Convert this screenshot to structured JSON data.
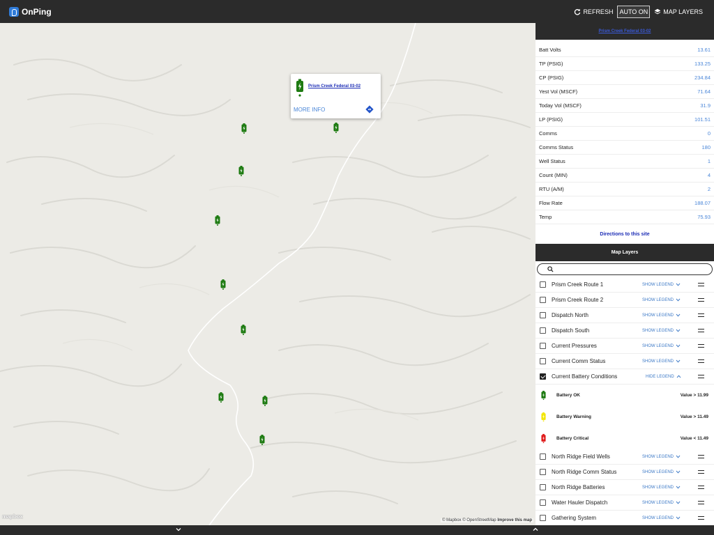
{
  "header": {
    "app_name": "OnPing",
    "refresh_label": "REFRESH",
    "auto_label": "AUTO ON",
    "map_layers_label": "MAP LAYERS"
  },
  "map": {
    "popup": {
      "title": "Prism Creek Federal 03-02",
      "more_info_label": "MORE INFO"
    },
    "brand": "mapbox",
    "attribution": "© Mapbox © OpenStreetMap",
    "improve_label": "Improve this map",
    "marker_color": "#1e7b12"
  },
  "site_panel": {
    "title": "Prism Creek Federal 03-02",
    "metrics": [
      {
        "label": "Batt Volts",
        "value": "13.61"
      },
      {
        "label": "TP (PSIG)",
        "value": "133.25"
      },
      {
        "label": "CP (PSIG)",
        "value": "234.84"
      },
      {
        "label": "Yest Vol (MSCF)",
        "value": "71.64"
      },
      {
        "label": "Today Vol (MSCF)",
        "value": "31.9"
      },
      {
        "label": "LP (PSIG)",
        "value": "101.51"
      },
      {
        "label": "Comms",
        "value": "0"
      },
      {
        "label": "Comms Status",
        "value": "180"
      },
      {
        "label": "Well Status",
        "value": "1"
      },
      {
        "label": "Count (MIN)",
        "value": "4"
      },
      {
        "label": "RTU (A/M)",
        "value": "2"
      },
      {
        "label": "Flow Rate",
        "value": "188.07"
      },
      {
        "label": "Temp",
        "value": "75.93"
      }
    ],
    "directions_label": "Directions to this site"
  },
  "layers_panel": {
    "title": "Map Layers",
    "search_placeholder": "",
    "show_legend_label": "SHOW LEGEND",
    "hide_legend_label": "HIDE LEGEND",
    "layers_before": [
      {
        "name": "Prism Creek Route 1",
        "checked": false
      },
      {
        "name": "Prism Creek Route 2",
        "checked": false
      },
      {
        "name": "Dispatch North",
        "checked": false
      },
      {
        "name": "Dispatch South",
        "checked": false
      },
      {
        "name": "Current Pressures",
        "checked": false
      },
      {
        "name": "Current Comm Status",
        "checked": false
      }
    ],
    "expanded_layer": {
      "name": "Current Battery Conditions",
      "checked": true
    },
    "legend": [
      {
        "name": "Battery OK",
        "value": "Value > 11.99",
        "color": "#1e7b12"
      },
      {
        "name": "Battery Warning",
        "value": "Value > 11.49",
        "color": "#f2e600"
      },
      {
        "name": "Battery Critical",
        "value": "Value < 11.49",
        "color": "#e01b1b"
      }
    ],
    "layers_after": [
      {
        "name": "North Ridge Field Wells",
        "checked": false
      },
      {
        "name": "North Ridge Comm Status",
        "checked": false
      },
      {
        "name": "North Ridge Batteries",
        "checked": false
      },
      {
        "name": "Water Hauler Dispatch",
        "checked": false
      },
      {
        "name": "Gathering System",
        "checked": false
      }
    ]
  }
}
